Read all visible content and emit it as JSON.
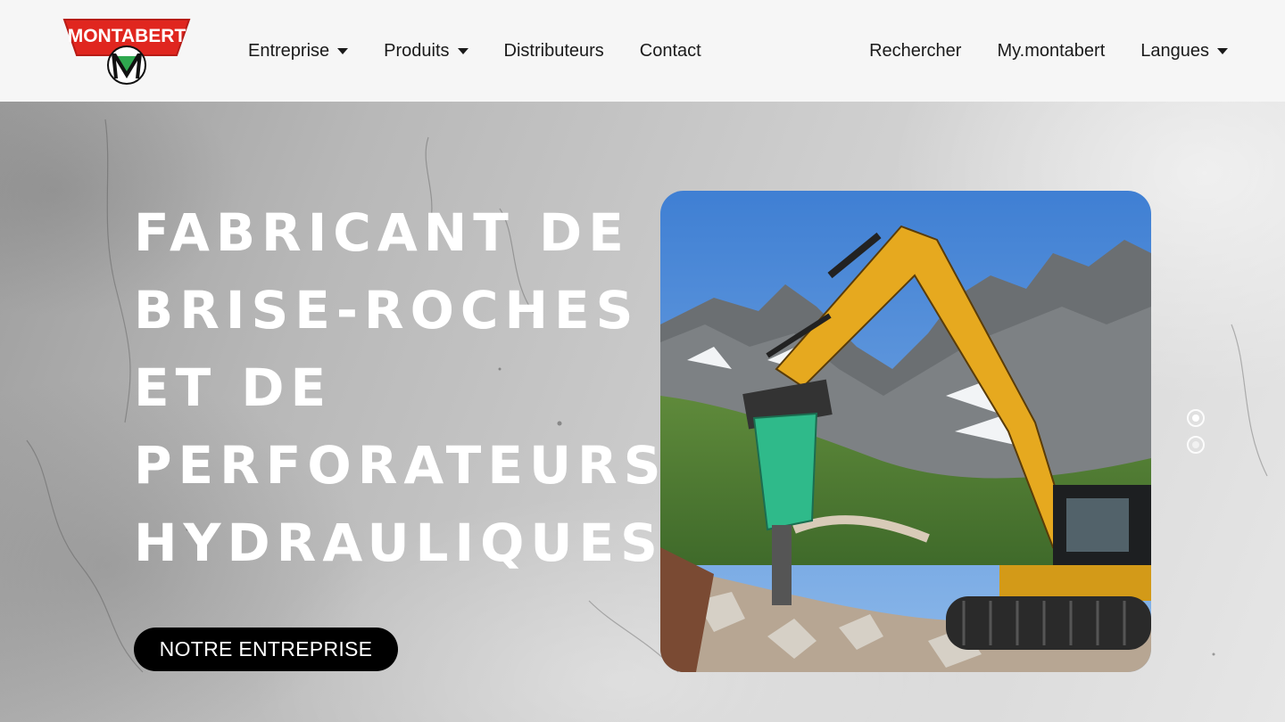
{
  "brand": {
    "name": "MONTABERT",
    "emblem_letter": "M"
  },
  "nav": {
    "left": [
      {
        "label": "Entreprise",
        "has_dropdown": true
      },
      {
        "label": "Produits",
        "has_dropdown": true
      },
      {
        "label": "Distributeurs",
        "has_dropdown": false
      },
      {
        "label": "Contact",
        "has_dropdown": false
      }
    ],
    "right": [
      {
        "label": "Rechercher",
        "has_dropdown": false
      },
      {
        "label": "My.montabert",
        "has_dropdown": false
      },
      {
        "label": "Langues",
        "has_dropdown": true
      }
    ]
  },
  "hero": {
    "headline_lines": [
      "FABRICANT DE",
      "BRISE-ROCHES",
      "ET DE",
      "PERFORATEURS",
      "HYDRAULIQUES"
    ],
    "cta_label": "NOTRE ENTREPRISE",
    "slider": {
      "slide_count": 2,
      "active_index": 0
    }
  },
  "colors": {
    "brand_red": "#e0261f",
    "brand_green": "#2fa84f",
    "cta_background": "#000000",
    "header_background": "#f6f6f6"
  }
}
